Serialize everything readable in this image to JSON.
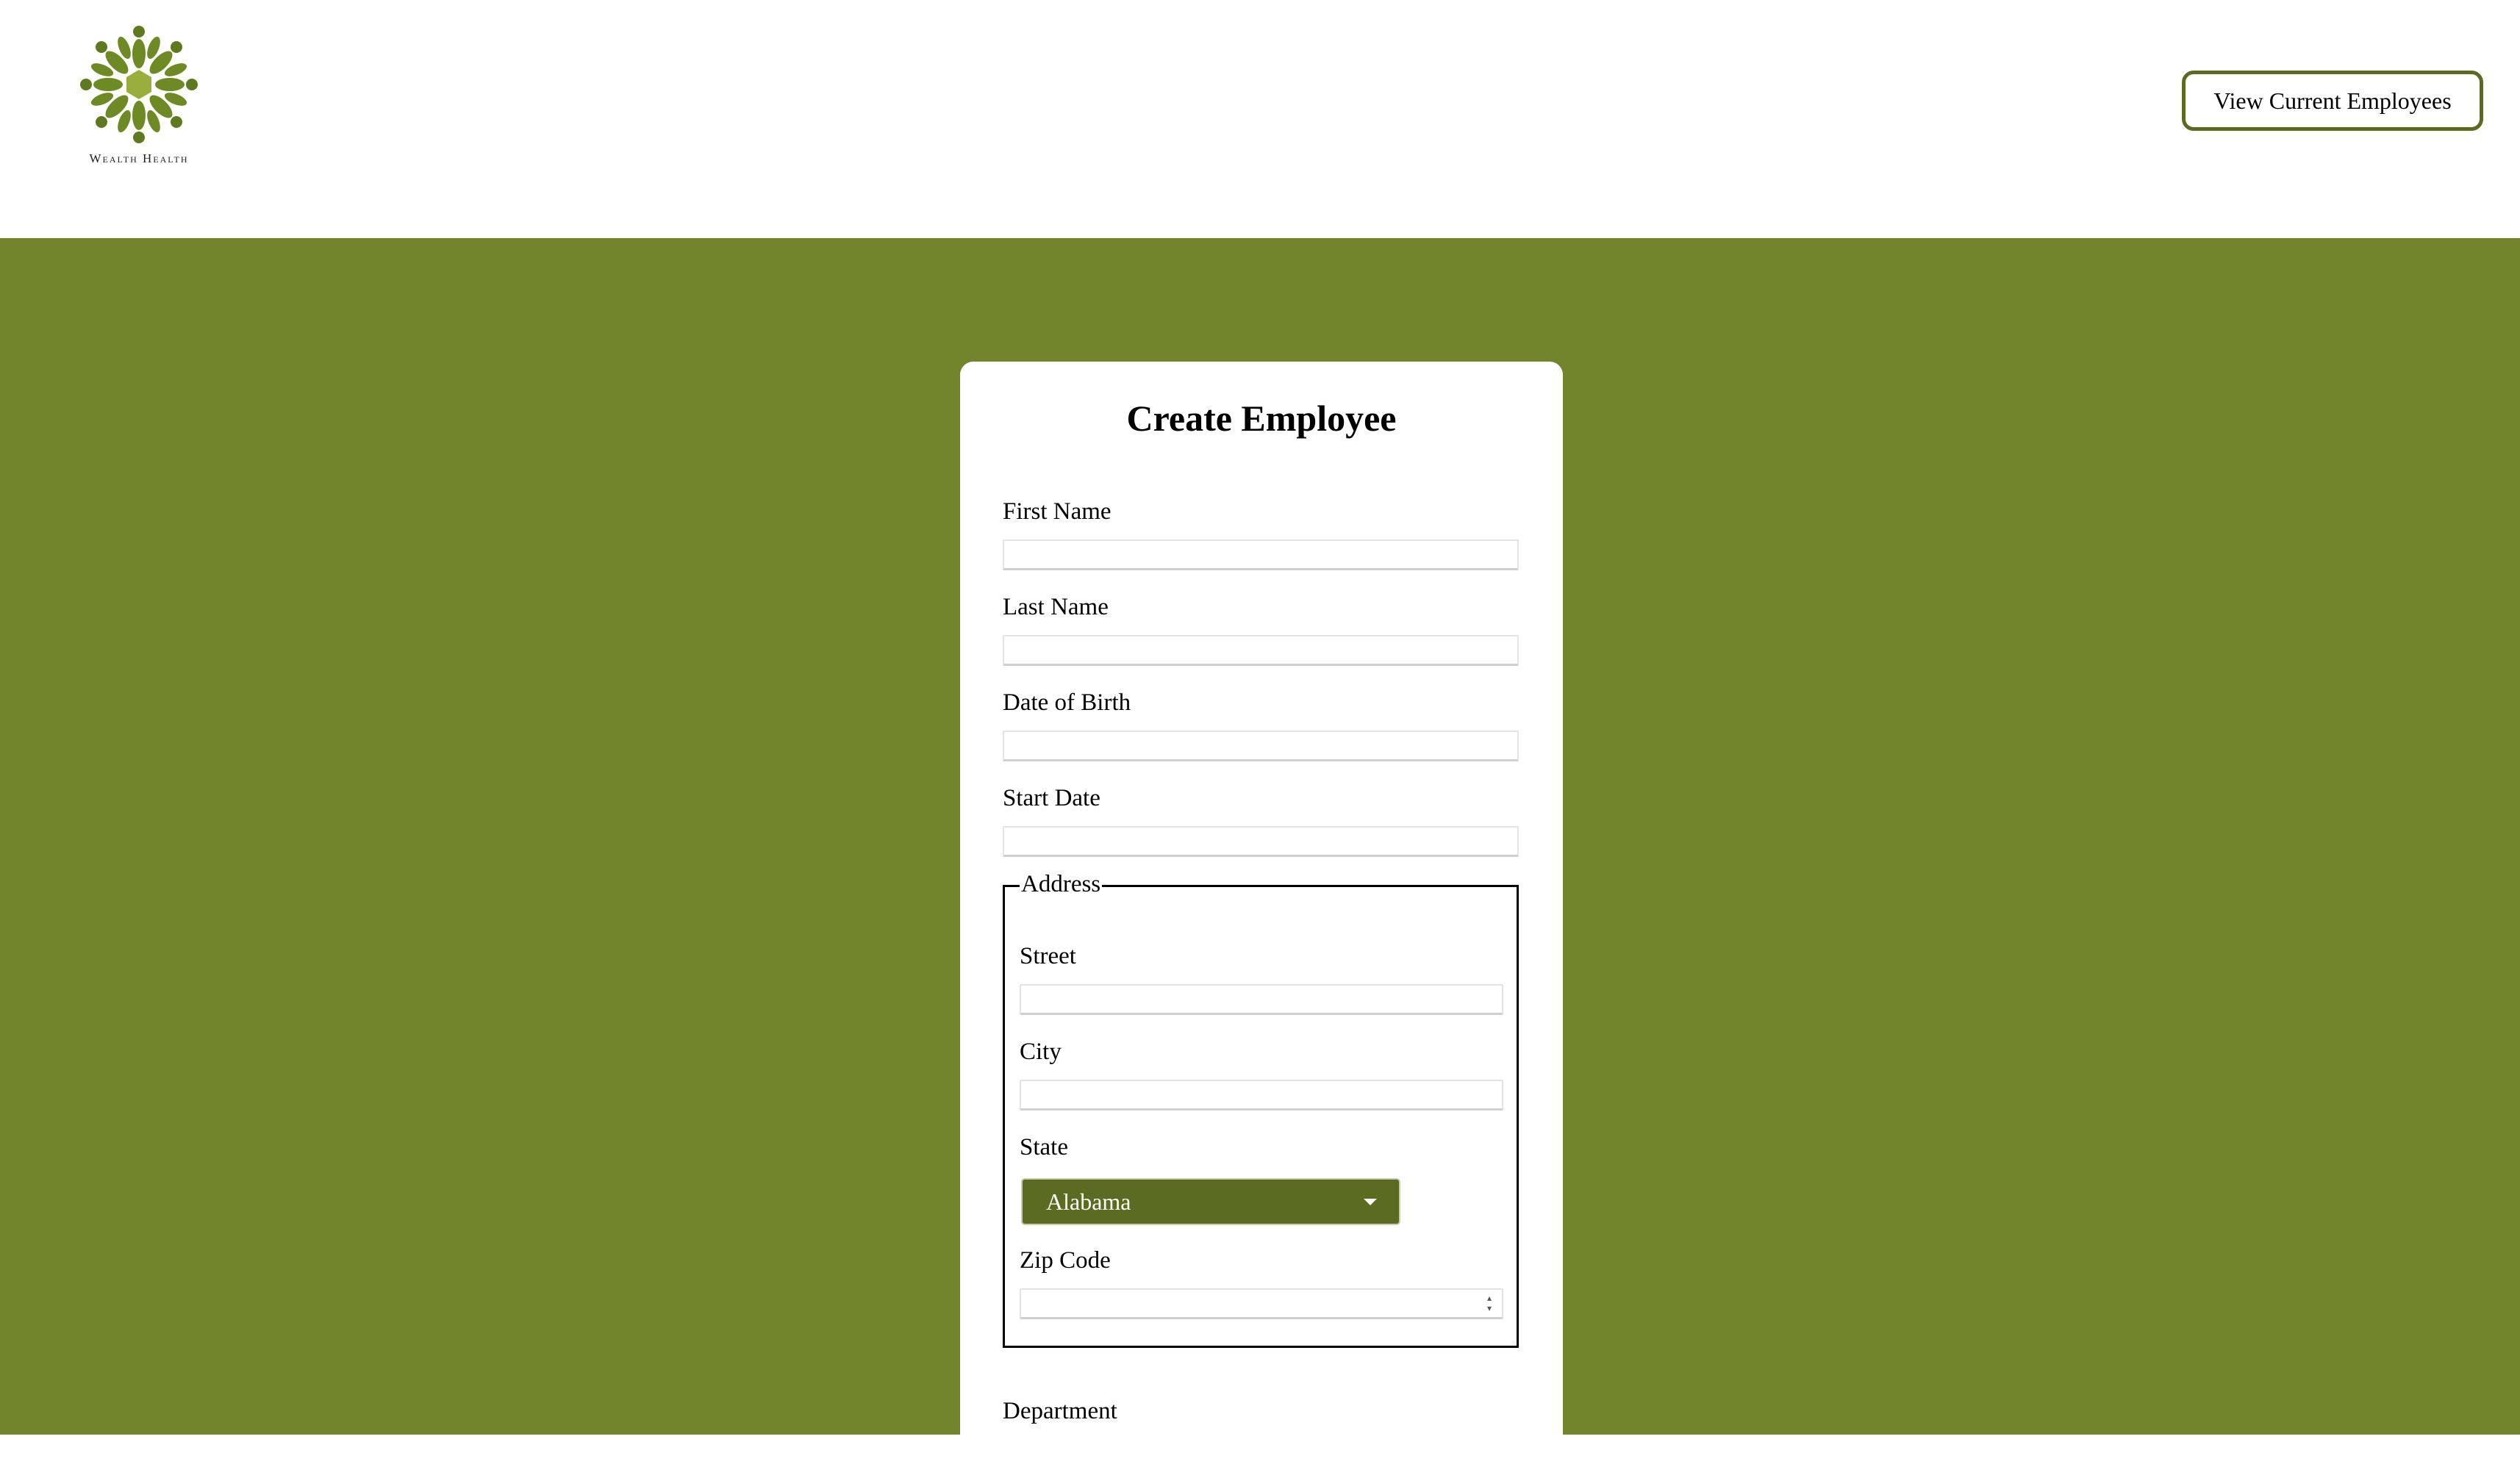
{
  "header": {
    "logo_text": "Wealth Health",
    "view_employees_label": "View Current Employees"
  },
  "form": {
    "title": "Create Employee",
    "first_name_label": "First Name",
    "last_name_label": "Last Name",
    "date_of_birth_label": "Date of Birth",
    "start_date_label": "Start Date",
    "address": {
      "legend": "Address",
      "street_label": "Street",
      "city_label": "City",
      "state_label": "State",
      "state_selected": "Alabama",
      "zip_label": "Zip Code"
    },
    "department_label": "Department"
  },
  "colors": {
    "brand_green": "#73852c",
    "dark_green": "#5b6b22"
  }
}
